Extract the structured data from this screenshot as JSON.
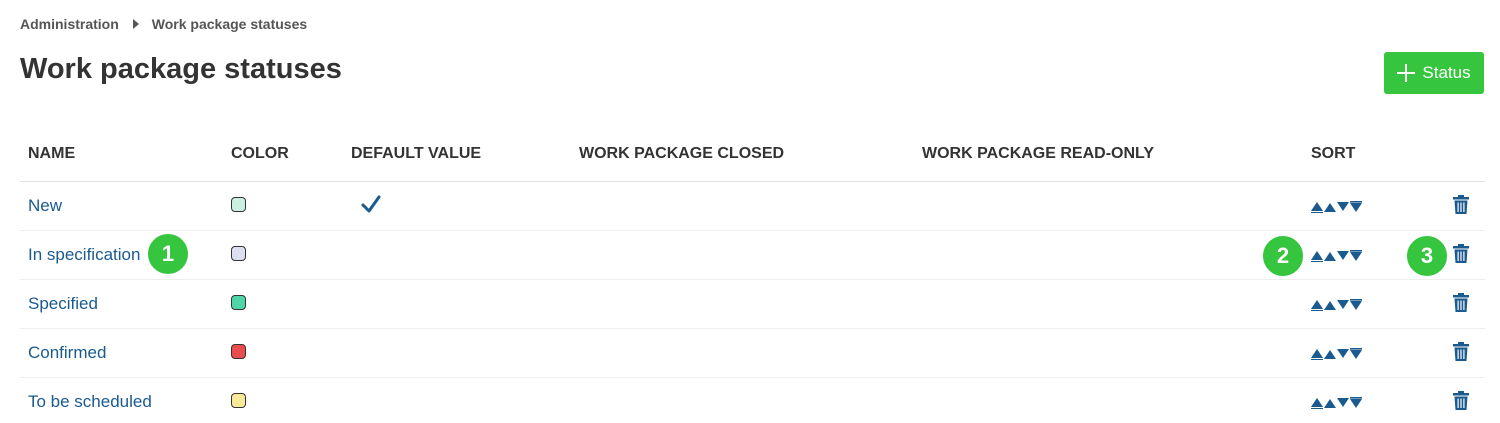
{
  "breadcrumb": {
    "root": "Administration",
    "current": "Work package statuses"
  },
  "page": {
    "title": "Work package statuses",
    "add_button_label": "Status"
  },
  "columns": [
    "NAME",
    "COLOR",
    "DEFAULT VALUE",
    "WORK PACKAGE CLOSED",
    "WORK PACKAGE READ-ONLY",
    "SORT"
  ],
  "rows": [
    {
      "name": "New",
      "color": "#c9f0e0",
      "default": true
    },
    {
      "name": "In specification",
      "color": "#dcdff0",
      "default": false
    },
    {
      "name": "Specified",
      "color": "#4fd6a8",
      "default": false
    },
    {
      "name": "Confirmed",
      "color": "#e94d4d",
      "default": false
    },
    {
      "name": "To be scheduled",
      "color": "#fbe99a",
      "default": false
    }
  ],
  "callouts": [
    "1",
    "2",
    "3"
  ],
  "colors": {
    "accent": "#35c53f",
    "link": "#1a5a8e"
  },
  "icons": {
    "breadcrumb_separator": "caret-right-icon",
    "add": "plus-icon",
    "default_check": "checkmark-icon",
    "delete": "trash-icon",
    "sort": [
      "move-to-top-icon",
      "move-up-icon",
      "move-down-icon",
      "move-to-bottom-icon"
    ]
  }
}
